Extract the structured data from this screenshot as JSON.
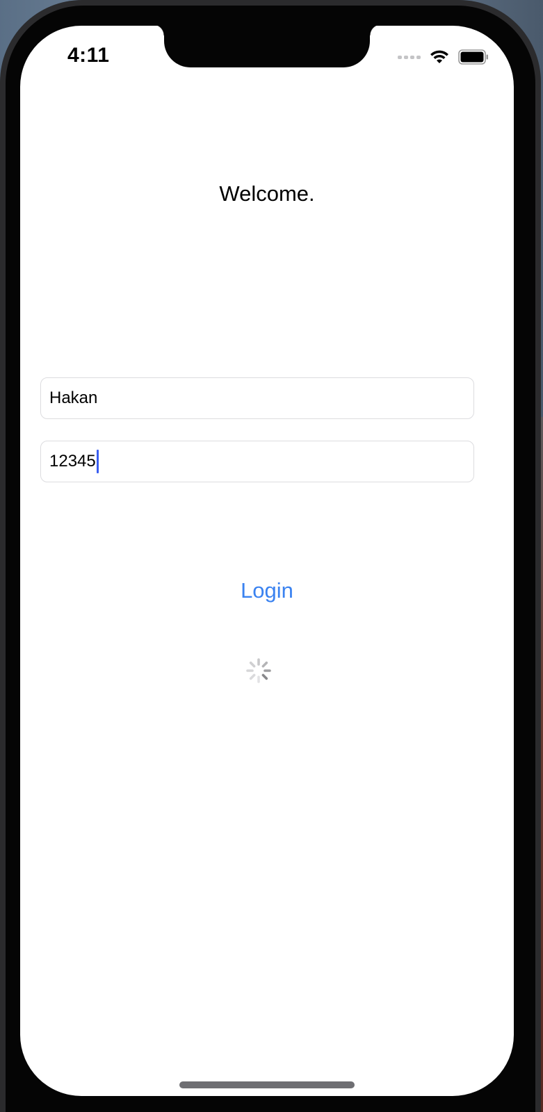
{
  "status_bar": {
    "time": "4:11"
  },
  "screen": {
    "title": "Welcome.",
    "username_field": {
      "value": "Hakan"
    },
    "password_field": {
      "value": "12345"
    },
    "login_button_label": "Login"
  },
  "colors": {
    "accent": "#3a82f0",
    "caret": "#3a5ef0",
    "field_border": "#dcdcdf"
  },
  "icons": [
    "signal-icon",
    "wifi-icon",
    "battery-icon",
    "activity-spinner-icon"
  ]
}
